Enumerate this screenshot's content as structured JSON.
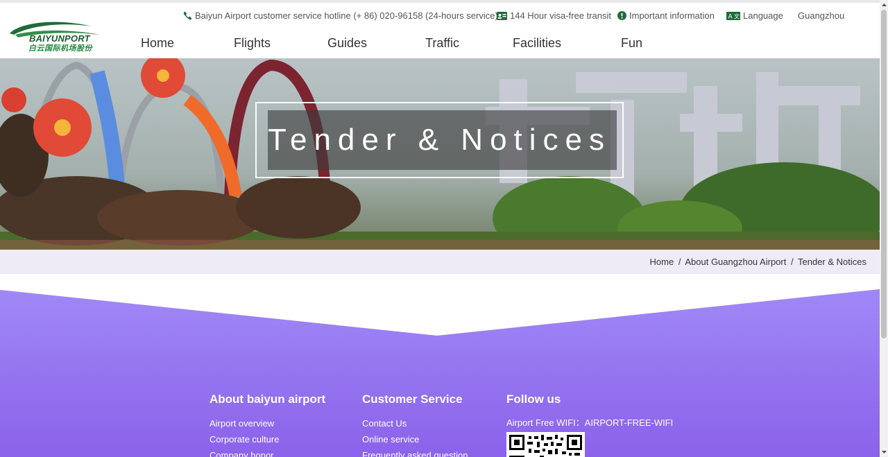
{
  "colors": {
    "brand_green": "#1f6b3a",
    "footer_purple_top": "#9b7ef4",
    "footer_purple_bottom": "#8c62ea",
    "breadcrumb_bg": "#efebf6"
  },
  "logo": {
    "name_en": "BAIYUNPORT",
    "name_cn": "白云国际机场股份",
    "icon": "baiyun-airport-logo"
  },
  "topbar": {
    "hotline": "Baiyun Airport customer service hotline (+ 86) 020-96158 (24-hours service)",
    "hotline_icon": "phone-icon",
    "visa": "144 Hour visa-free transit",
    "visa_icon": "id-card-icon",
    "important": "Important information",
    "important_icon": "info-circle-icon",
    "language": "Language",
    "language_icon": "translate-icon",
    "city": "Guangzhou"
  },
  "nav": {
    "items": [
      {
        "label": "Home"
      },
      {
        "label": "Flights"
      },
      {
        "label": "Guides"
      },
      {
        "label": "Traffic"
      },
      {
        "label": "Facilities"
      },
      {
        "label": "Fun"
      }
    ]
  },
  "banner": {
    "title": "Tender & Notices"
  },
  "breadcrumb": {
    "home": "Home",
    "separator": "/",
    "parent": "About Guangzhou Airport",
    "current": "Tender & Notices"
  },
  "footer": {
    "about": {
      "heading": "About baiyun airport",
      "links": [
        "Airport overview",
        "Corporate culture",
        "Company honor"
      ]
    },
    "service": {
      "heading": "Customer Service",
      "links": [
        "Contact Us",
        "Online service",
        "Frequently asked question"
      ]
    },
    "follow": {
      "heading": "Follow us",
      "wifi": "Airport Free WIFI：AIRPORT-FREE-WIFI"
    }
  }
}
